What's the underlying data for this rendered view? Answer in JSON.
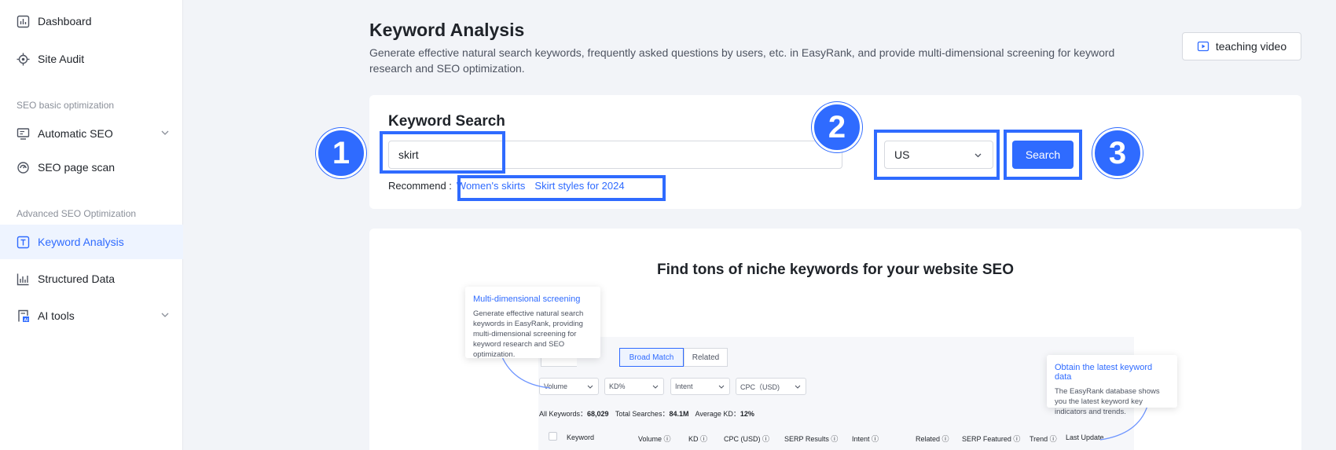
{
  "sidebar": {
    "items": [
      {
        "label": "Dashboard",
        "icon": "dashboard-icon"
      },
      {
        "label": "Site Audit",
        "icon": "target-icon"
      },
      {
        "label": "Automatic SEO",
        "icon": "monitor-icon"
      },
      {
        "label": "SEO page scan",
        "icon": "scan-icon"
      },
      {
        "label": "Keyword Analysis",
        "icon": "keyword-icon"
      },
      {
        "label": "Structured Data",
        "icon": "chart-icon"
      },
      {
        "label": "AI tools",
        "icon": "ai-icon"
      }
    ],
    "sections": [
      "SEO basic optimization",
      "Advanced SEO Optimization"
    ]
  },
  "header": {
    "title": "Keyword Analysis",
    "description": "Generate effective natural search keywords, frequently asked questions by users, etc. in EasyRank, and provide multi-dimensional screening for keyword research and SEO optimization.",
    "teaching_video": "teaching video"
  },
  "search": {
    "title": "Keyword Search",
    "value": "skirt",
    "country": "US",
    "button": "Search",
    "recommend_label": "Recommend :",
    "recommend": [
      "Women's skirts",
      "Skirt styles for 2024"
    ]
  },
  "annotations": {
    "one": "1",
    "two": "2",
    "three": "3"
  },
  "promo": {
    "title": "Find tons of niche keywords for your website SEO",
    "tip1": {
      "title": "Multi-dimensional screening",
      "text": "Generate effective natural search keywords in EasyRank, providing multi-dimensional screening for keyword research and SEO optimization."
    },
    "tip2": {
      "title": "Obtain the latest keyword data",
      "text": "The EasyRank database shows you the latest keyword key indicators and trends."
    },
    "tabs": [
      "Broad Match",
      "Related"
    ],
    "filters": [
      "Volume",
      "KD%",
      "Intent",
      "CPC（USD)"
    ],
    "stats": {
      "all_label": "All Keywords：",
      "all": "68,029",
      "total_label": "Total Searches：",
      "total": "84.1M",
      "kd_label": "Average KD：",
      "kd": "12%"
    },
    "columns": [
      "Keyword",
      "Volume ⓘ",
      "KD ⓘ",
      "CPC (USD) ⓘ",
      "SERP Results ⓘ",
      "Intent ⓘ",
      "Related ⓘ",
      "SERP Featured ⓘ",
      "Trend ⓘ",
      "Last Update"
    ]
  },
  "colors": {
    "accent": "#2f6bff"
  }
}
